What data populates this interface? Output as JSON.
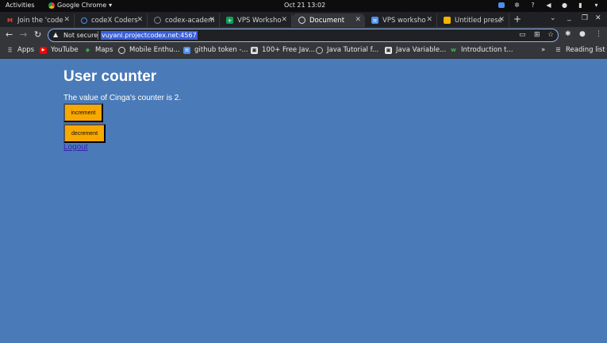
{
  "system": {
    "activities": "Activities",
    "app_name": "Google Chrome",
    "clock": "Oct 21  13:02"
  },
  "tabs": [
    {
      "title": "Join the 'code"
    },
    {
      "title": "codeX Coders"
    },
    {
      "title": "codex-academ"
    },
    {
      "title": "VPS Worksho"
    },
    {
      "title": "Document"
    },
    {
      "title": "VPS worksho"
    },
    {
      "title": "Untitled prese"
    }
  ],
  "omnibox": {
    "security": "Not secure",
    "url": "vuyani.projectcodex.net:4567"
  },
  "bookmarks": [
    {
      "label": "Apps"
    },
    {
      "label": "YouTube"
    },
    {
      "label": "Maps"
    },
    {
      "label": "Mobile Enthu..."
    },
    {
      "label": "github token -..."
    },
    {
      "label": "100+ Free Jav..."
    },
    {
      "label": "Java Tutorial f..."
    },
    {
      "label": "Java Variable..."
    },
    {
      "label": "Introduction t..."
    },
    {
      "label": "Reading list"
    }
  ],
  "page": {
    "title": "User counter",
    "message": "The value of Cinga's counter is 2.",
    "increment_label": "increment",
    "decrement_label": "decrement",
    "logout_label": "Logout"
  },
  "colors": {
    "page_bg": "#4a7ab8",
    "button_bg": "#f8a800",
    "link": "#3a1fb0"
  }
}
